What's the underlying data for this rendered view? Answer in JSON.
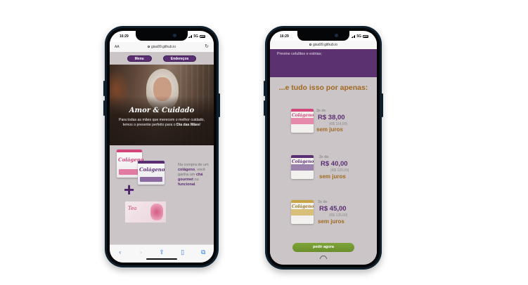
{
  "left_phone": {
    "status": {
      "time": "16:29",
      "network": "5G"
    },
    "browser": {
      "text_size": "AA",
      "url": "gisa99.github.io",
      "reload_icon": "reload-icon"
    },
    "nav": {
      "menu_label": "Menu",
      "address_label": "Endereços"
    },
    "hero": {
      "title": "Amor & Cuidado",
      "text_before": "Para todas as mães que merecem o melhor cuidado, temos o presente perfeito para o ",
      "text_bold": "Dia das Mães",
      "text_after": "!"
    },
    "promo": {
      "product_label_1": "Colágeno",
      "product_label_2": "Colágeno",
      "tea_label": "Tea",
      "plus": "+",
      "line_1": "Na compra de um ",
      "line_1_bold": "colágeno",
      "line_2": ", você ganha um ",
      "line_2_bold": "chá gourmet",
      "line_3": " ou ",
      "line_3_bold": "funcional",
      "line_end": "."
    },
    "toolbar_icons": [
      "back-icon",
      "forward-icon",
      "share-icon",
      "bookmarks-icon",
      "tabs-icon"
    ]
  },
  "right_phone": {
    "status": {
      "time": "16:29",
      "network": "5G"
    },
    "browser": {
      "text_size": "AA",
      "url": "gisa99.github.io",
      "reload_icon": "reload-icon"
    },
    "band_text": "Previne celulites e estrias;",
    "headline": "...e tudo isso por apenas:",
    "offers": [
      {
        "qty": "3x de",
        "price": "R$ 38,00",
        "full": "(R$ 114,00)",
        "juros": "sem juros",
        "label": "Colágeno"
      },
      {
        "qty": "3x de",
        "price": "R$ 40,00",
        "full": "(R$ 120,00)",
        "juros": "sem juros",
        "label": "Colágeno"
      },
      {
        "qty": "3x de",
        "price": "R$ 45,00",
        "full": "(R$ 135,00)",
        "juros": "sem juros",
        "label": "Colágeno"
      }
    ],
    "cta": "pedir agora"
  },
  "colors": {
    "purple": "#5a2e72",
    "gold": "#a0691f",
    "green_cta": "#6a8f2c",
    "page_bg": "#cbc5c8",
    "safari_blue": "#2f7de1"
  }
}
